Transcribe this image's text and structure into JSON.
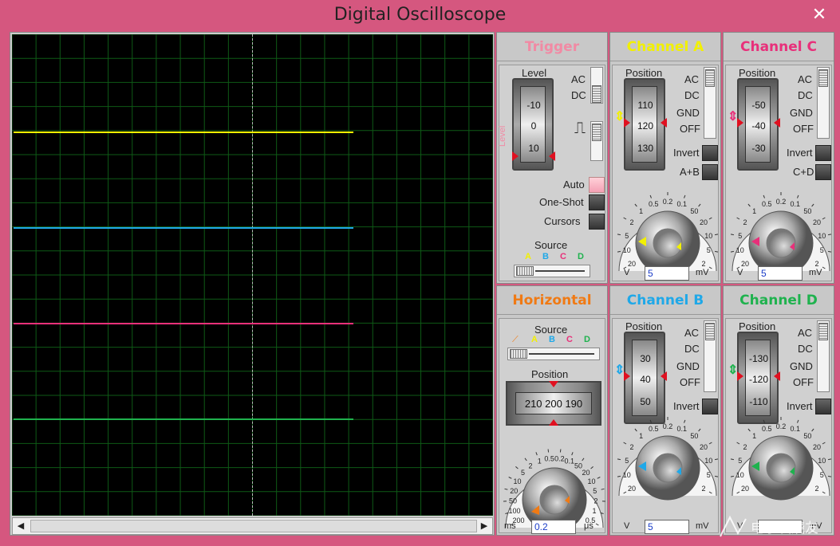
{
  "window": {
    "title": "Digital Oscilloscope",
    "close": "✕"
  },
  "colors": {
    "chA": "#f2f000",
    "chB": "#1fa8e8",
    "chC": "#e8307a",
    "chD": "#1fb24e",
    "trigger": "#f18aa4",
    "horizontal": "#f07a14"
  },
  "trigger": {
    "title": "Trigger",
    "level_label": "Level",
    "side_label": "Level",
    "drum": [
      "-10",
      "0",
      "10"
    ],
    "ac": "AC",
    "dc": "DC",
    "auto": "Auto",
    "one_shot": "One-Shot",
    "cursors": "Cursors",
    "source_label": "Source",
    "sources": [
      "A",
      "B",
      "C",
      "D"
    ]
  },
  "channels": {
    "a": {
      "title": "Channel A",
      "position_label": "Position",
      "drum": [
        "110",
        "120",
        "130"
      ],
      "modes": [
        "AC",
        "DC",
        "GND",
        "OFF"
      ],
      "invert": "Invert",
      "extra": "A+B",
      "value": "5"
    },
    "c": {
      "title": "Channel C",
      "position_label": "Position",
      "drum": [
        "-50",
        "-40",
        "-30"
      ],
      "modes": [
        "AC",
        "DC",
        "GND",
        "OFF"
      ],
      "invert": "Invert",
      "extra": "C+D",
      "value": "5"
    },
    "b": {
      "title": "Channel B",
      "position_label": "Position",
      "drum": [
        "30",
        "40",
        "50"
      ],
      "modes": [
        "AC",
        "DC",
        "GND",
        "OFF"
      ],
      "invert": "Invert",
      "value": "5"
    },
    "d": {
      "title": "Channel D",
      "position_label": "Position",
      "drum": [
        "-130",
        "-120",
        "-110"
      ],
      "modes": [
        "AC",
        "DC",
        "GND",
        "OFF"
      ],
      "invert": "Invert",
      "value": ""
    }
  },
  "volt_knob": {
    "scale": [
      "0.5",
      "0.2",
      "0.1",
      "50",
      "20",
      "10",
      "5",
      "2",
      "1",
      "2",
      "5",
      "10",
      "20"
    ],
    "unit_left": "V",
    "unit_right": "mV"
  },
  "horizontal": {
    "title": "Horizontal",
    "source_label": "Source",
    "sources": [
      "A",
      "B",
      "C",
      "D"
    ],
    "position_label": "Position",
    "drum": "210 200 190",
    "scale": [
      "0.5",
      "0.2",
      "0.1",
      "50",
      "20",
      "10",
      "5",
      "2",
      "1",
      "0.5",
      "1",
      "2",
      "5",
      "10",
      "20",
      "50",
      "100",
      "200"
    ],
    "unit_left": "ms",
    "unit_right": "μs",
    "value": "0.2"
  },
  "watermark": "电子发烧友"
}
